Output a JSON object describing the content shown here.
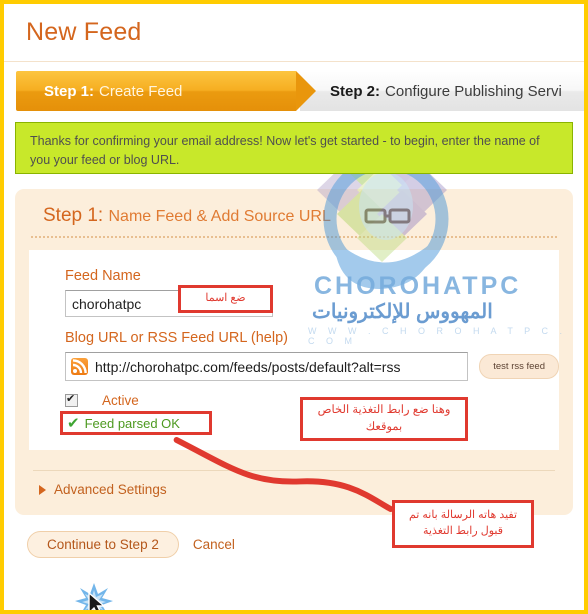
{
  "page": {
    "title": "New Feed",
    "border_color": "#ffcc00"
  },
  "tabs": [
    {
      "id": "step1",
      "strong": "Step 1:",
      "rest": "Create Feed",
      "active": true
    },
    {
      "id": "step2",
      "strong": "Step 2:",
      "rest": "Configure Publishing Servi",
      "active": false
    }
  ],
  "notice": {
    "text": "Thanks for confirming your email address! Now let's get started - to begin, enter the name of you your feed or blog URL.",
    "background": "#c8e82a",
    "border": "#8ab400"
  },
  "step_panel": {
    "heading_strong": "Step 1:",
    "heading_rest": "Name Feed & Add Source URL",
    "feed_name": {
      "label": "Feed Name",
      "value": "chorohatpc"
    },
    "source_url": {
      "label": "Blog URL or RSS Feed URL (help)",
      "value": "http://chorohatpc.com/feeds/posts/default?alt=rss",
      "icon": "rss-icon",
      "test_button_label": "test rss feed"
    },
    "active": {
      "label": "Active",
      "checked": true
    },
    "parsed_status": {
      "icon": "check-icon",
      "text": "Feed parsed OK",
      "color": "#4d9a20"
    },
    "advanced_settings": {
      "label": "Advanced Settings",
      "icon": "triangle-right-icon"
    }
  },
  "actions": {
    "continue_label": "Continue to Step 2",
    "cancel_label": "Cancel"
  },
  "annotations": [
    {
      "id": "name",
      "text": "ضع اسما"
    },
    {
      "id": "url",
      "text": "وهنا ضع رابط التغذية الخاص بموقعك"
    },
    {
      "id": "message",
      "text": "تفيد هاته الرسالة بانه تم قبول رابط التغذية"
    }
  ],
  "watermark": {
    "brand_en": "CHOROHATPC",
    "brand_ar": "المهووس للإلكترونيات",
    "url": "W W W . C H O R O H A T P C . C O M"
  }
}
